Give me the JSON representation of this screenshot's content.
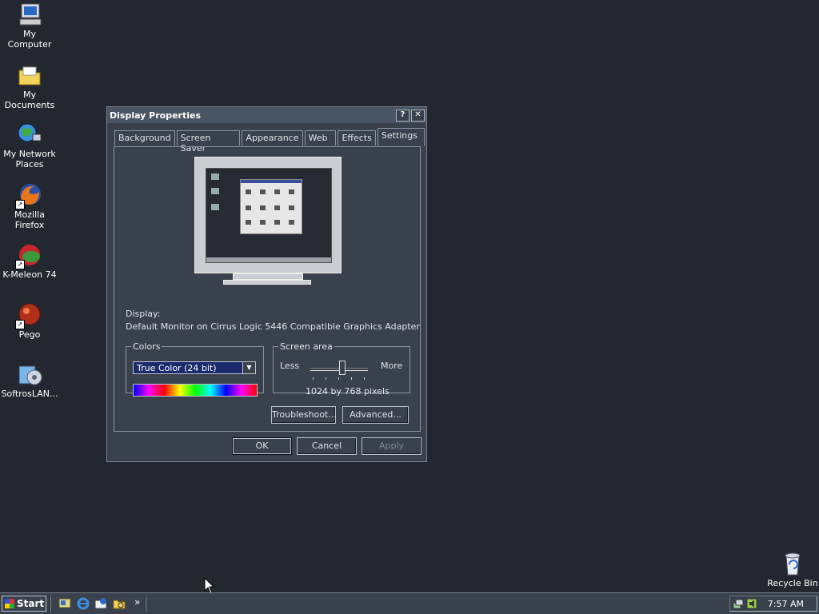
{
  "desktop": {
    "icons": [
      {
        "label": "My Computer",
        "icon": "computer-icon"
      },
      {
        "label": "My Documents",
        "icon": "folder-icon"
      },
      {
        "label": "My Network Places",
        "icon": "network-icon"
      },
      {
        "label": "Mozilla Firefox",
        "icon": "firefox-icon"
      },
      {
        "label": "K-Meleon 74",
        "icon": "kmeleon-icon"
      },
      {
        "label": "Pego",
        "icon": "pego-icon"
      },
      {
        "label": "SoftrosLAN...",
        "icon": "softros-icon"
      },
      {
        "label": "Recycle Bin",
        "icon": "recycle-bin-icon"
      }
    ]
  },
  "dialog": {
    "title": "Display Properties",
    "help_glyph": "?",
    "close_glyph": "✕",
    "tabs": [
      "Background",
      "Screen Saver",
      "Appearance",
      "Web",
      "Effects",
      "Settings"
    ],
    "active_tab": "Settings",
    "display_label": "Display:",
    "display_value": "Default Monitor on Cirrus Logic 5446 Compatible Graphics Adapter",
    "colors_legend": "Colors",
    "colors_value": "True Color (24 bit)",
    "screen_area_legend": "Screen area",
    "less_label": "Less",
    "more_label": "More",
    "resolution_text": "1024 by 768 pixels",
    "slider_level": 0.55,
    "troubleshoot_label": "Troubleshoot...",
    "advanced_label": "Advanced...",
    "ok_label": "OK",
    "cancel_label": "Cancel",
    "apply_label": "Apply"
  },
  "taskbar": {
    "start_label": "Start",
    "chevron": "»",
    "clock": "7:57 AM"
  },
  "colors": {
    "desktop_bg": "#232830",
    "window_bg": "#39414c",
    "selection": "#1b2a6b"
  }
}
